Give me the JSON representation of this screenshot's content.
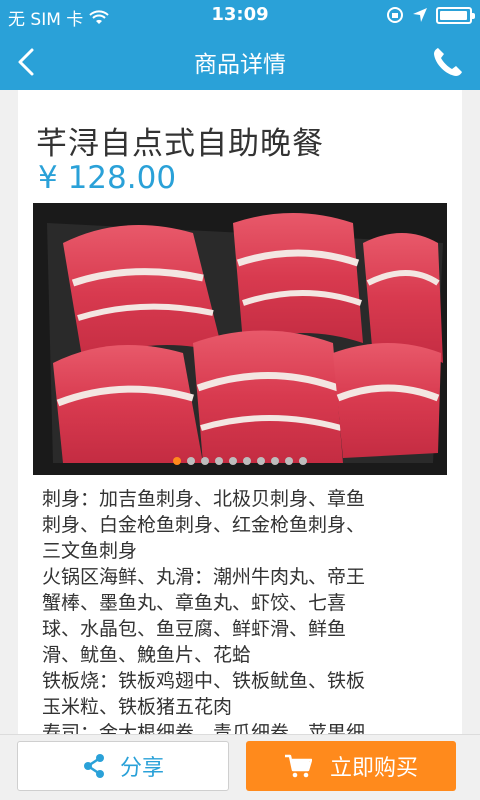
{
  "status_bar": {
    "carrier": "无 SIM 卡",
    "time": "13:09",
    "battery_level": 0.95
  },
  "nav": {
    "title": "商品详情",
    "back_icon": "chevron-left-icon",
    "phone_icon": "phone-icon"
  },
  "product": {
    "title": "芊浔自点式自助晚餐",
    "price": "¥ 128.00",
    "image": {
      "description_icon": "product-photo",
      "carousel_count": 10,
      "carousel_active_index": 0
    },
    "description_lines": [
      "刺身：加吉鱼刺身、北极贝刺身、章鱼",
      "刺身、白金枪鱼刺身、红金枪鱼刺身、",
      "三文鱼刺身",
      "火锅区海鲜、丸滑：潮州牛肉丸、帝王",
      "蟹棒、墨鱼丸、章鱼丸、虾饺、七喜",
      "球、水晶包、鱼豆腐、鲜虾滑、鲜鱼",
      "滑、鱿鱼、鮸鱼片、花蛤",
      "铁板烧：铁板鸡翅中、铁板鱿鱼、铁板",
      "玉米粒、铁板猪五花肉",
      "寿司：金大根细卷、青瓜细卷、苹果细"
    ]
  },
  "actions": {
    "share_label": "分享",
    "buy_label": "立即购买"
  },
  "colors": {
    "brand_blue": "#2aa1d8",
    "accent_orange": "#ff8a1c"
  }
}
